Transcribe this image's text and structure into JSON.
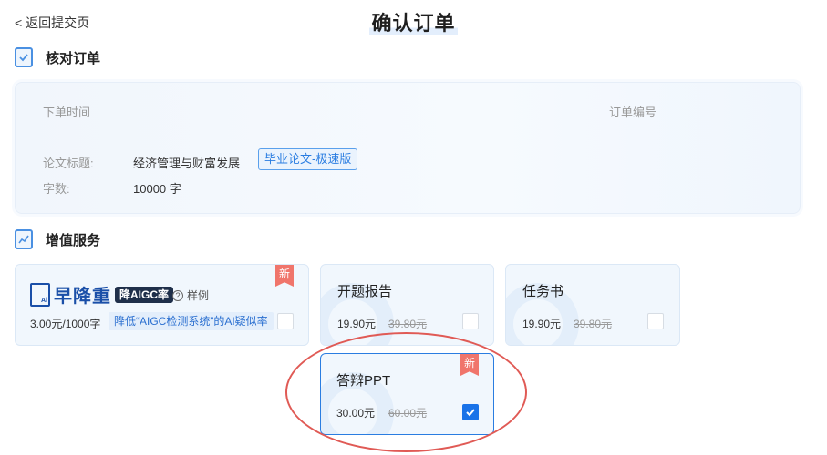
{
  "header": {
    "back_label": "< 返回提交页",
    "title": "确认订单"
  },
  "order_section": {
    "title": "核对订单",
    "icon": "check-document-icon",
    "order_time_label": "下单时间",
    "order_number_label": "订单编号",
    "thesis_title_label": "论文标题:",
    "thesis_title_value": "经济管理与财富发展",
    "version_tag": "毕业论文-极速版",
    "word_count_label": "字数:",
    "word_count_value": "10000 字"
  },
  "services_section": {
    "title": "增值服务",
    "icon": "chart-icon",
    "new_badge": "新",
    "aigc": {
      "logo_text": "早降重",
      "logo_pill": "降AIGC率",
      "logo_mark": "Ai",
      "sample_label": "样例",
      "price": "3.00元/1000字",
      "note": "降低“AIGC检测系统”的AI疑似率",
      "checked": false
    },
    "proposal": {
      "name": "开题报告",
      "price": "19.90元",
      "old_price": "39.80元",
      "checked": false
    },
    "task_book": {
      "name": "任务书",
      "price": "19.90元",
      "old_price": "39.80元",
      "checked": false
    },
    "defense_ppt": {
      "name": "答辩PPT",
      "price": "30.00元",
      "old_price": "60.00元",
      "checked": true
    }
  },
  "colors": {
    "accent": "#1a73e8",
    "badge": "#f0756b",
    "annotation": "#e05a55"
  }
}
